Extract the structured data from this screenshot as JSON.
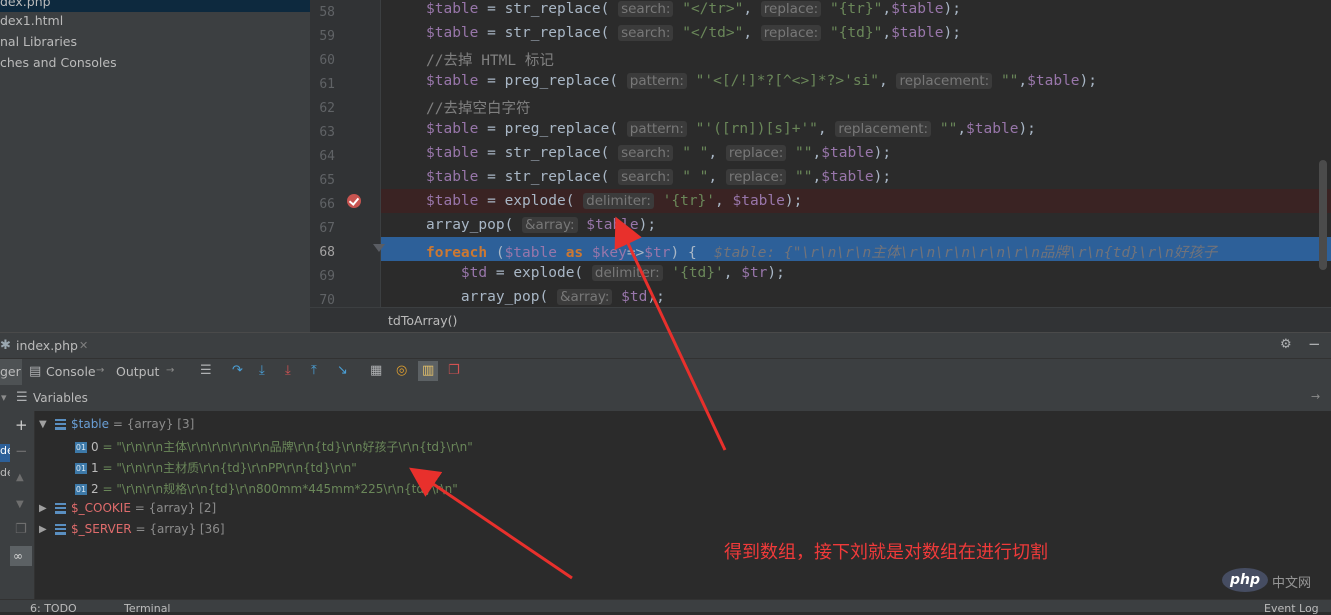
{
  "project_tree": [
    "dex.php",
    "dex1.html",
    "nal Libraries",
    "ches and Consoles"
  ],
  "editor": {
    "line_numbers": [
      "58",
      "59",
      "60",
      "61",
      "62",
      "63",
      "64",
      "65",
      "66",
      "67",
      "68",
      "69",
      "70"
    ],
    "breadcrumb": "tdToArray()",
    "lines": [
      {
        "t": [
          [
            "var",
            "$table"
          ],
          [
            "txt",
            " = str_replace( "
          ],
          [
            "hint",
            "search:"
          ],
          [
            "str",
            " \"</tr>\""
          ],
          [
            "txt",
            ", "
          ],
          [
            "hint",
            "replace:"
          ],
          [
            "str",
            " \"{tr}\""
          ],
          [
            "txt",
            ","
          ],
          [
            "var",
            "$table"
          ],
          [
            "txt",
            ");"
          ]
        ]
      },
      {
        "t": [
          [
            "var",
            "$table"
          ],
          [
            "txt",
            " = str_replace( "
          ],
          [
            "hint",
            "search:"
          ],
          [
            "str",
            " \"</td>\""
          ],
          [
            "txt",
            ", "
          ],
          [
            "hint",
            "replace:"
          ],
          [
            "str",
            " \"{td}\""
          ],
          [
            "txt",
            ","
          ],
          [
            "var",
            "$table"
          ],
          [
            "txt",
            ");"
          ]
        ]
      },
      {
        "t": [
          [
            "cmt",
            "//去掉 HTML 标记"
          ]
        ]
      },
      {
        "t": [
          [
            "var",
            "$table"
          ],
          [
            "txt",
            " = preg_replace( "
          ],
          [
            "hint",
            "pattern:"
          ],
          [
            "str",
            " \"'<[/!]*?[^<>]*?>'si\""
          ],
          [
            "txt",
            ", "
          ],
          [
            "hint",
            "replacement:"
          ],
          [
            "str",
            " \"\""
          ],
          [
            "txt",
            ","
          ],
          [
            "var",
            "$table"
          ],
          [
            "txt",
            ");"
          ]
        ]
      },
      {
        "t": [
          [
            "cmt",
            "//去掉空白字符"
          ]
        ]
      },
      {
        "t": [
          [
            "var",
            "$table"
          ],
          [
            "txt",
            " = preg_replace( "
          ],
          [
            "hint",
            "pattern:"
          ],
          [
            "str",
            " \"'([rn])[s]+'\""
          ],
          [
            "txt",
            ", "
          ],
          [
            "hint",
            "replacement:"
          ],
          [
            "str",
            " \"\""
          ],
          [
            "txt",
            ","
          ],
          [
            "var",
            "$table"
          ],
          [
            "txt",
            ");"
          ]
        ]
      },
      {
        "t": [
          [
            "var",
            "$table"
          ],
          [
            "txt",
            " = str_replace( "
          ],
          [
            "hint",
            "search:"
          ],
          [
            "str",
            " \" \""
          ],
          [
            "txt",
            ", "
          ],
          [
            "hint",
            "replace:"
          ],
          [
            "str",
            " \"\""
          ],
          [
            "txt",
            ","
          ],
          [
            "var",
            "$table"
          ],
          [
            "txt",
            ");"
          ]
        ]
      },
      {
        "t": [
          [
            "var",
            "$table"
          ],
          [
            "txt",
            " = str_replace( "
          ],
          [
            "hint",
            "search:"
          ],
          [
            "str",
            " \" \""
          ],
          [
            "txt",
            ", "
          ],
          [
            "hint",
            "replace:"
          ],
          [
            "str",
            " \"\""
          ],
          [
            "txt",
            ","
          ],
          [
            "var",
            "$table"
          ],
          [
            "txt",
            ");"
          ]
        ]
      },
      {
        "t": [
          [
            "var",
            "$table"
          ],
          [
            "txt",
            " = explode( "
          ],
          [
            "hint",
            "delimiter:"
          ],
          [
            "str",
            " '{tr}'"
          ],
          [
            "txt",
            ", "
          ],
          [
            "var",
            "$table"
          ],
          [
            "txt",
            ");"
          ]
        ]
      },
      {
        "t": [
          [
            "txt",
            "array_pop( "
          ],
          [
            "hint",
            "&array:"
          ],
          [
            "var",
            " $table"
          ],
          [
            "txt",
            ");"
          ]
        ]
      },
      {
        "t": [
          [
            "kw",
            "foreach"
          ],
          [
            "txt",
            " ("
          ],
          [
            "var",
            "$table"
          ],
          [
            "txt",
            " "
          ],
          [
            "kw",
            "as"
          ],
          [
            "txt",
            " "
          ],
          [
            "var",
            "$key"
          ],
          [
            "txt",
            "=>"
          ],
          [
            "var",
            "$tr"
          ],
          [
            "txt",
            ") {  "
          ],
          [
            "inl",
            "$table: {\"\\r\\n\\r\\n主体\\r\\n\\r\\n\\r\\n\\r\\n品牌\\r\\n{td}\\r\\n好孩子"
          ]
        ]
      },
      {
        "t": [
          [
            "txt",
            "    "
          ],
          [
            "var",
            "$td"
          ],
          [
            "txt",
            " = explode( "
          ],
          [
            "hint",
            "delimiter:"
          ],
          [
            "str",
            " '{td}'"
          ],
          [
            "txt",
            ", "
          ],
          [
            "var",
            "$tr"
          ],
          [
            "txt",
            ");"
          ]
        ]
      },
      {
        "t": [
          [
            "txt",
            "    array_pop( "
          ],
          [
            "hint",
            "&array:"
          ],
          [
            "var",
            " $td"
          ],
          [
            "txt",
            ");"
          ]
        ]
      }
    ]
  },
  "debug": {
    "file_tab": "index.php",
    "tabs": [
      "ger",
      "Console",
      "Output"
    ],
    "variables_title": "Variables",
    "vars": [
      {
        "name": "$table",
        "type": "= {array} [3]",
        "expanded": true
      },
      {
        "idx": "0",
        "value": "= \"\\r\\n\\r\\n主体\\r\\n\\r\\n\\r\\n\\r\\n品牌\\r\\n{td}\\r\\n好孩子\\r\\n{td}\\r\\n\""
      },
      {
        "idx": "1",
        "value": "= \"\\r\\n\\r\\n主材质\\r\\n{td}\\r\\nPP\\r\\n{td}\\r\\n\""
      },
      {
        "idx": "2",
        "value": "= \"\\r\\n\\r\\n规格\\r\\n{td}\\r\\n800mm*445mm*225\\r\\n{td}\\r\\n\""
      },
      {
        "name": "$_COOKIE",
        "type": "= {array} [2]",
        "expanded": false
      },
      {
        "name": "$_SERVER",
        "type": "= {array} [36]",
        "expanded": false
      }
    ],
    "left_strip": [
      "de",
      "de"
    ]
  },
  "annotation": "得到数组，接下刘就是对数组在进行切割",
  "status_bar": {
    "todo": "6: TODO",
    "terminal": "Terminal",
    "event_log": "Event Log"
  },
  "watermark": "php中文网"
}
